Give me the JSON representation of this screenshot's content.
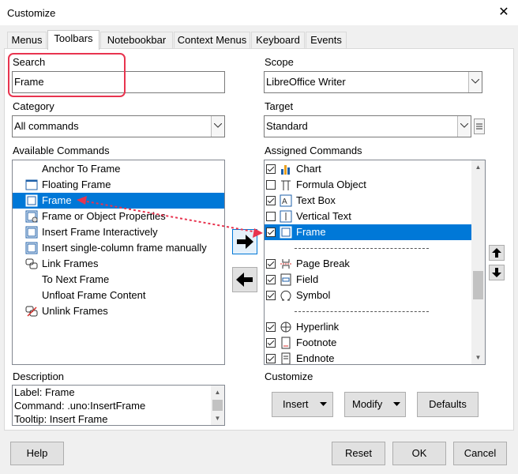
{
  "window": {
    "title": "Customize",
    "close_glyph": "✕"
  },
  "tabs": [
    "Menus",
    "Toolbars",
    "Notebookbar",
    "Context Menus",
    "Keyboard",
    "Events"
  ],
  "search": {
    "label": "Search",
    "value": "Frame"
  },
  "category": {
    "label": "Category",
    "value": "All commands"
  },
  "available": {
    "label": "Available Commands",
    "items": [
      {
        "label": "Anchor To Frame",
        "icon": "none"
      },
      {
        "label": "Floating Frame",
        "icon": "floating-frame-icon"
      },
      {
        "label": "Frame",
        "icon": "frame-icon",
        "selected": true
      },
      {
        "label": "Frame or Object Properties",
        "icon": "frame-properties-icon"
      },
      {
        "label": "Insert Frame Interactively",
        "icon": "frame-icon"
      },
      {
        "label": "Insert single-column frame manually",
        "icon": "frame-icon"
      },
      {
        "label": "Link Frames",
        "icon": "link-frames-icon"
      },
      {
        "label": "To Next Frame",
        "icon": "none"
      },
      {
        "label": "Unfloat Frame Content",
        "icon": "none"
      },
      {
        "label": "Unlink Frames",
        "icon": "unlink-frames-icon"
      }
    ]
  },
  "scope": {
    "label": "Scope",
    "value": "LibreOffice Writer"
  },
  "target": {
    "label": "Target",
    "value": "Standard"
  },
  "assigned": {
    "label": "Assigned Commands",
    "items": [
      {
        "label": "Chart",
        "checked": true,
        "icon": "chart-icon"
      },
      {
        "label": "Formula Object",
        "checked": false,
        "icon": "formula-icon"
      },
      {
        "label": "Text Box",
        "checked": true,
        "icon": "text-box-icon"
      },
      {
        "label": "Vertical Text",
        "checked": false,
        "icon": "vertical-text-icon"
      },
      {
        "label": "Frame",
        "checked": true,
        "icon": "frame-icon",
        "selected": true
      },
      {
        "separator": true
      },
      {
        "label": "Page Break",
        "checked": true,
        "icon": "page-break-icon"
      },
      {
        "label": "Field",
        "checked": true,
        "icon": "field-icon"
      },
      {
        "label": "Symbol",
        "checked": true,
        "icon": "symbol-icon"
      },
      {
        "separator": true
      },
      {
        "label": "Hyperlink",
        "checked": true,
        "icon": "hyperlink-icon"
      },
      {
        "label": "Footnote",
        "checked": true,
        "icon": "footnote-icon"
      },
      {
        "label": "Endnote",
        "checked": true,
        "icon": "endnote-icon"
      }
    ]
  },
  "description": {
    "label": "Description",
    "lines": [
      "Label: Frame",
      "Command: .uno:InsertFrame",
      "Tooltip: Insert Frame"
    ]
  },
  "customize": {
    "label": "Customize",
    "insert": "Insert",
    "modify": "Modify",
    "defaults": "Defaults"
  },
  "footer": {
    "help": "Help",
    "reset": "Reset",
    "ok": "OK",
    "cancel": "Cancel"
  },
  "colors": {
    "selection": "#0078d7",
    "highlight_box": "#e8344f",
    "annotation_arrow": "#e8344f"
  }
}
